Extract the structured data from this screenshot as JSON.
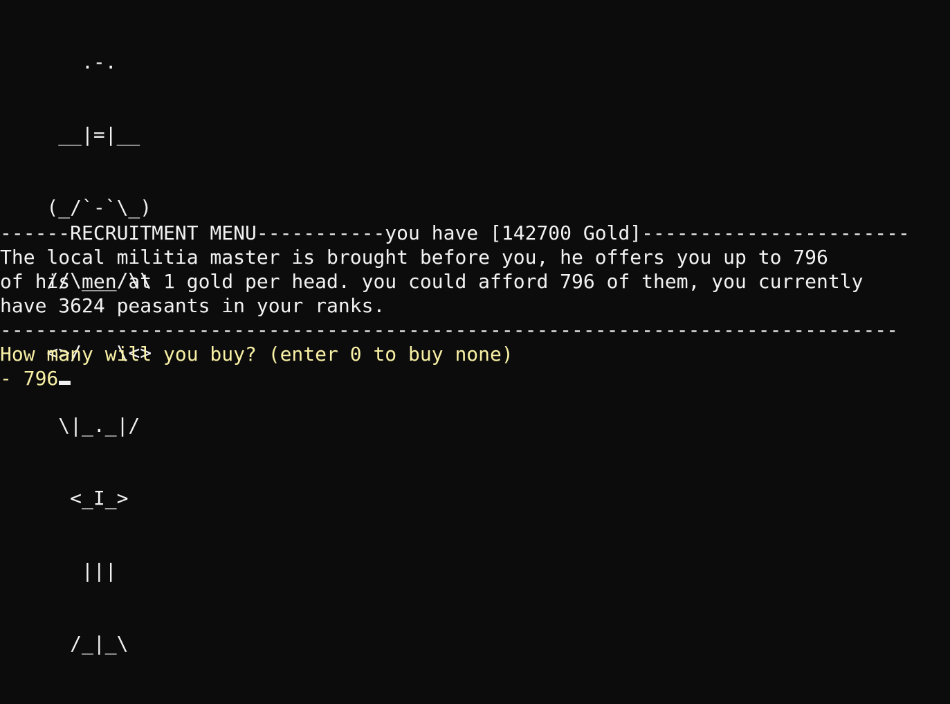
{
  "ascii_art": [
    "       .-.",
    "     __|=|__",
    "    (_/`-`\\_)",
    "    //\\___/\\\\",
    "    <>/   \\<>",
    "     \\|_._|/",
    "      <_I_>",
    "       |||",
    "      /_|_\\"
  ],
  "menu_header": "------RECRUITMENT MENU-----------you have [142700 Gold]-----------------------",
  "description_lines": [
    "The local militia master is brought before you, he offers you up to 796",
    "of his men at 1 gold per head. you could afford 796 of them, you currently",
    "have 3624 peasants in your ranks."
  ],
  "separator": "-----------------------------------------------------------------------------",
  "prompt": "How many will you buy? (enter 0 to buy none)",
  "input_prefix": "- ",
  "input_value": "796",
  "colors": {
    "background": "#0c0c0c",
    "text": "#f2f2f2",
    "prompt": "#f9f1a5"
  }
}
